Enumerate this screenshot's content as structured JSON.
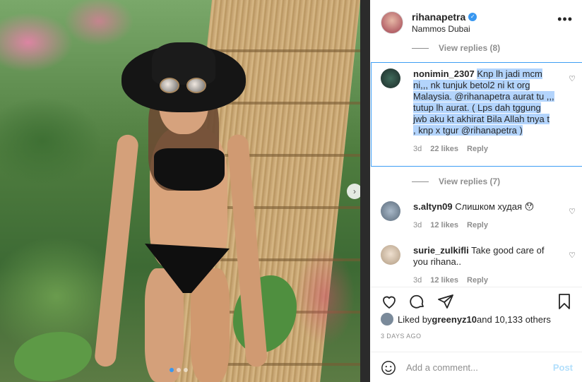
{
  "post": {
    "username": "rihanapetra",
    "location": "Nammos Dubai",
    "more_icon": "more-horizontal-icon"
  },
  "comments": {
    "view_replies_top": "View replies (8)",
    "highlighted": {
      "username": "nonimin_2307",
      "text_part1": "Knp lh jadi mcm ni,,, nk tunjuk betol2 ni kt org Malaysia. @rihanapetra aurat tu ,,, tutup lh aurat. ( Lps dah tggung jwb aku kt akhirat Bila Allah tnya t , knp x tgur @rihanapetra )",
      "time": "3d",
      "likes": "22 likes",
      "reply": "Reply",
      "view_replies": "View replies (7)"
    },
    "c2": {
      "username": "s.altyn09",
      "text": "Слишком худая 😯",
      "time": "3d",
      "likes": "12 likes",
      "reply": "Reply"
    },
    "c3": {
      "username": "surie_zulkifli",
      "text": "Take good care of you rihana..",
      "time": "3d",
      "likes": "12 likes",
      "reply": "Reply"
    }
  },
  "actions": {
    "liked_by_prefix": "Liked by ",
    "liked_by_user": "greenyz10",
    "liked_by_suffix": " and 10,133 others",
    "date": "3 DAYS AGO",
    "add_comment_placeholder": "Add a comment...",
    "post_label": "Post"
  },
  "colors": {
    "accent": "#3897f0",
    "selection": "#b3d4fc",
    "muted": "#8e8e8e",
    "post_disabled": "#b2dffc"
  },
  "carousel": {
    "pages": 3,
    "active_page": 1
  }
}
